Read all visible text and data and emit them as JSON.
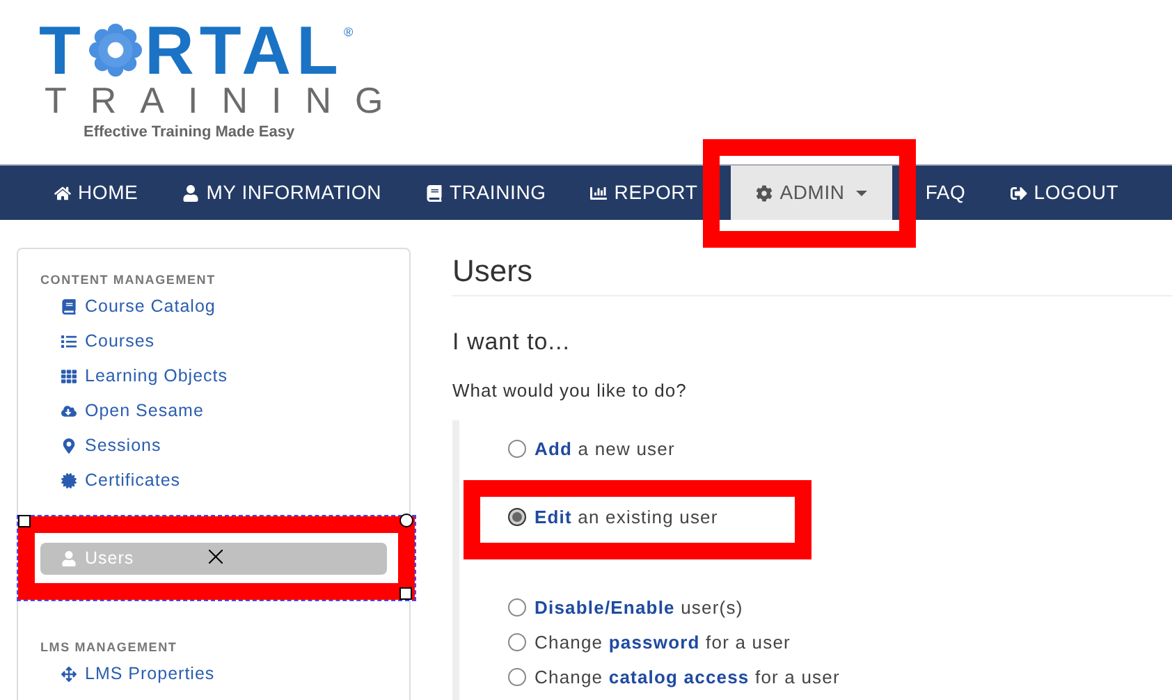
{
  "logo": {
    "letters_before": "T",
    "letters_after": "RTAL",
    "registered": "®",
    "subtitle": "TRAINING",
    "tagline": "Effective Training Made Easy"
  },
  "nav": [
    {
      "label": "HOME",
      "selected": false
    },
    {
      "label": "MY INFORMATION",
      "selected": false
    },
    {
      "label": "TRAINING",
      "selected": false
    },
    {
      "label": "REPORT",
      "selected": false
    },
    {
      "label": "ADMIN",
      "selected": true
    },
    {
      "label": "FAQ",
      "selected": false
    },
    {
      "label": "LOGOUT",
      "selected": false
    }
  ],
  "sidebar": {
    "sections": [
      {
        "heading": "CONTENT MANAGEMENT",
        "items": [
          {
            "label": "Course Catalog",
            "selected": false
          },
          {
            "label": "Courses",
            "selected": false
          },
          {
            "label": "Learning Objects",
            "selected": false
          },
          {
            "label": "Open Sesame",
            "selected": false
          },
          {
            "label": "Sessions",
            "selected": false
          },
          {
            "label": "Certificates",
            "selected": false
          }
        ]
      },
      {
        "items": [
          {
            "label": "Users",
            "selected": true
          }
        ]
      },
      {
        "heading": "LMS MANAGEMENT",
        "items": [
          {
            "label": "LMS Properties",
            "selected": false
          }
        ]
      }
    ]
  },
  "main": {
    "title": "Users",
    "subtitle": "I want to...",
    "question": "What would you like to do?",
    "option_groups": [
      [
        {
          "label": "**Add** a new user",
          "selected": false
        }
      ],
      [
        {
          "label": "**Edit** an existing user",
          "selected": true
        }
      ],
      [
        {
          "label": "**Disable/Enable** user(s)",
          "selected": false
        },
        {
          "label": "Change **password** for a user",
          "selected": false
        },
        {
          "label": "Change **catalog access** for a user",
          "selected": false
        }
      ]
    ]
  }
}
